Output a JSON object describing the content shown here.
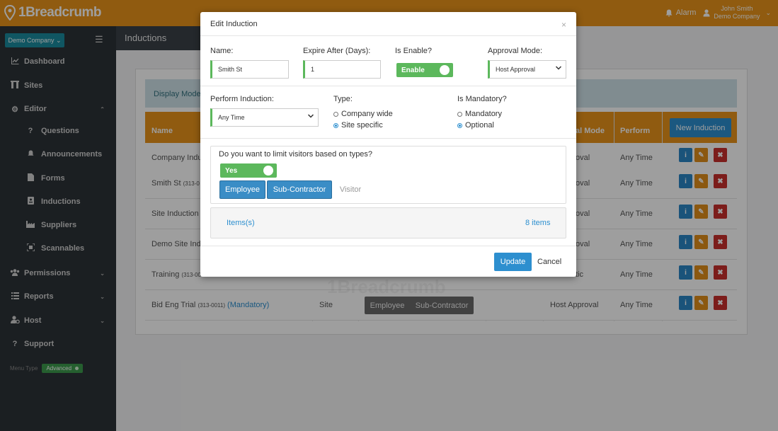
{
  "topbar": {
    "logo_text": "1Breadcrumb",
    "alarm_label": "Alarm",
    "user_name": "John Smith",
    "user_company": "Demo Company"
  },
  "sidebar": {
    "company_select": "Demo Company ⌄",
    "items": [
      {
        "label": "Dashboard",
        "icon": "chart-icon"
      },
      {
        "label": "Sites",
        "icon": "building-icon"
      },
      {
        "label": "Editor",
        "icon": "gear-icon"
      },
      {
        "label": "Questions",
        "icon": "question-icon"
      },
      {
        "label": "Announcements",
        "icon": "bell-icon"
      },
      {
        "label": "Forms",
        "icon": "file-icon"
      },
      {
        "label": "Inductions",
        "icon": "id-card-icon"
      },
      {
        "label": "Suppliers",
        "icon": "industry-icon"
      },
      {
        "label": "Scannables",
        "icon": "qr-icon"
      },
      {
        "label": "Permissions",
        "icon": "users-icon"
      },
      {
        "label": "Reports",
        "icon": "list-icon"
      },
      {
        "label": "Host",
        "icon": "user-gear-icon"
      },
      {
        "label": "Support",
        "icon": "question-icon"
      }
    ],
    "menu_type_label": "Menu Type",
    "menu_type_value": "Advanced"
  },
  "page": {
    "tab_title": "Inductions",
    "display_mode_label": "Display Mode",
    "new_induction_label": "New Induction",
    "columns": {
      "name": "Name",
      "approval_mode": "al Mode",
      "perform": "Perform"
    },
    "rows": [
      {
        "name": "Company Indu",
        "code": "",
        "mandatory": "",
        "approval": "oval",
        "perform": "Any Time"
      },
      {
        "name": "Smith St",
        "code": "(313-0",
        "mandatory": "",
        "approval": "oval",
        "perform": "Any Time"
      },
      {
        "name": "Site Induction",
        "code": "",
        "mandatory": "",
        "approval": "oval",
        "perform": "Any Time"
      },
      {
        "name": "Demo Site Indu",
        "code": "",
        "mandatory": "",
        "approval": "oval",
        "perform": "Any Time"
      },
      {
        "name": "Training",
        "code": "(313-00",
        "mandatory": "",
        "approval": "tic",
        "perform": "Any Time"
      },
      {
        "name": "Bid Eng Trial",
        "code": "(313-0011)",
        "mandatory": "(Mandatory)",
        "type": "Site",
        "approval": "Host Approval",
        "perform": "Any Time"
      }
    ],
    "last_row_types": [
      "Employee",
      "Sub-Contractor"
    ],
    "watermark": "1Breadcrumb"
  },
  "modal": {
    "title": "Edit Induction",
    "close": "×",
    "name_label": "Name:",
    "name_value": "Smith St",
    "expire_label": "Expire After (Days):",
    "expire_value": "1",
    "enable_label": "Is Enable?",
    "enable_value": "Enable",
    "approval_label": "Approval Mode:",
    "approval_value": "Host Approval",
    "perform_label": "Perform Induction:",
    "perform_value": "Any Time",
    "type_label": "Type:",
    "type_options": [
      "Company wide",
      "Site specific"
    ],
    "type_selected": "Site specific",
    "mandatory_label": "Is Mandatory?",
    "mandatory_options": [
      "Mandatory",
      "Optional"
    ],
    "mandatory_selected": "Optional",
    "limit_question": "Do you want to limit visitors based on types?",
    "limit_value": "Yes",
    "visitor_types": [
      {
        "label": "Employee",
        "selected": true
      },
      {
        "label": "Sub-Contractor",
        "selected": true
      },
      {
        "label": "Visitor",
        "selected": false
      }
    ],
    "items_label": "Items(s)",
    "items_count": "8 items",
    "update_label": "Update",
    "cancel_label": "Cancel"
  }
}
